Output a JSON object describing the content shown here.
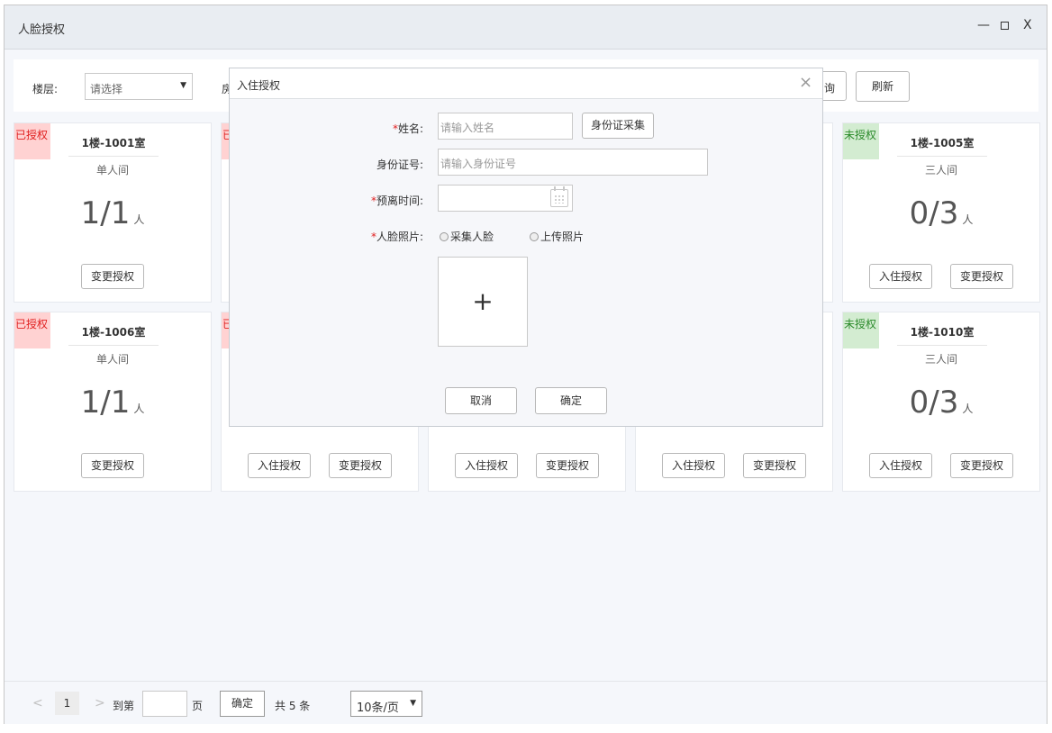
{
  "window": {
    "title": "人脸授权",
    "minimize": "—",
    "close": "X"
  },
  "filters": {
    "floor_label": "楼层:",
    "floor_placeholder": "请选择",
    "room_label_partial": "房",
    "query_partial": "询",
    "refresh": "刷新"
  },
  "rooms": [
    {
      "status": "已授权",
      "name": "1楼-1001室",
      "type": "单人间",
      "occupancy": "1/1",
      "unit": "人",
      "buttons": [
        "变更授权"
      ]
    },
    {
      "status": "已",
      "name": "",
      "type": "",
      "occupancy": "",
      "unit": "",
      "buttons": []
    },
    {
      "status": "未授权",
      "name": "1楼-1005室",
      "type": "三人间",
      "occupancy": "0/3",
      "unit": "人",
      "buttons": [
        "入住授权",
        "变更授权"
      ]
    },
    {
      "status": "已授权",
      "name": "1楼-1006室",
      "type": "单人间",
      "occupancy": "1/1",
      "unit": "人",
      "buttons": [
        "变更授权"
      ]
    },
    {
      "status": "已",
      "name": "",
      "type": "",
      "occupancy": "",
      "unit": "",
      "buttons": [
        "入住授权",
        "变更授权"
      ]
    },
    {
      "buttons": [
        "入住授权",
        "变更授权"
      ]
    },
    {
      "buttons": [
        "入住授权",
        "变更授权"
      ]
    },
    {
      "status": "未授权",
      "name": "1楼-1010室",
      "type": "三人间",
      "occupancy": "0/3",
      "unit": "人",
      "buttons": [
        "入住授权",
        "变更授权"
      ]
    }
  ],
  "colors": {
    "authorized_bg": "#ffd2d2",
    "authorized_text": "#e02020",
    "unauthorized_bg": "#d3ecd1",
    "unauthorized_text": "#2a8a2a"
  },
  "pagination": {
    "prev": "<",
    "current": "1",
    "next": ">",
    "goto": "到第",
    "page": "页",
    "confirm": "确定",
    "total": "共 5 条",
    "page_size": "10条/页"
  },
  "modal": {
    "title": "入住授权",
    "close": "×",
    "name_label": "姓名:",
    "name_placeholder": "请输入姓名",
    "idcard_button": "身份证采集",
    "idnum_label": "身份证号:",
    "idnum_placeholder": "请输入身份证号",
    "leave_label": "预离时间:",
    "face_label": "人脸照片:",
    "required_mark": "*",
    "options": [
      "采集人脸",
      "上传照片"
    ],
    "upload_plus": "+",
    "cancel": "取消",
    "ok": "确定"
  }
}
